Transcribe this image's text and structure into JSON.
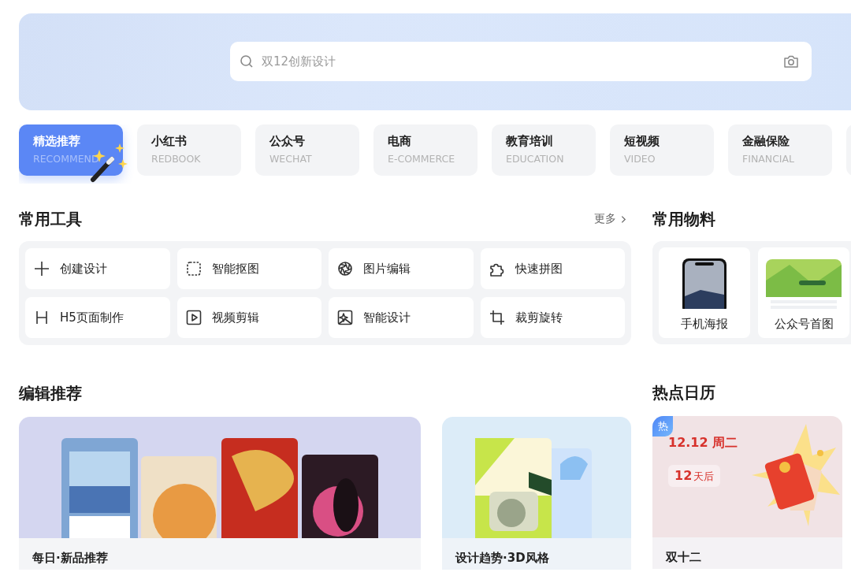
{
  "search": {
    "placeholder": "双12创新设计"
  },
  "categories": [
    {
      "title": "精选推荐",
      "subtitle": "RECOMMEND",
      "selected": true
    },
    {
      "title": "小红书",
      "subtitle": "REDBOOK",
      "selected": false
    },
    {
      "title": "公众号",
      "subtitle": "WECHAT",
      "selected": false
    },
    {
      "title": "电商",
      "subtitle": "E-COMMERCE",
      "selected": false
    },
    {
      "title": "教育培训",
      "subtitle": "EDUCATION",
      "selected": false
    },
    {
      "title": "短视频",
      "subtitle": "VIDEO",
      "selected": false
    },
    {
      "title": "金融保险",
      "subtitle": "FINANCIAL",
      "selected": false
    }
  ],
  "tools": {
    "title": "常用工具",
    "more": "更多",
    "items": [
      {
        "label": "创建设计"
      },
      {
        "label": "智能抠图"
      },
      {
        "label": "图片编辑"
      },
      {
        "label": "快速拼图"
      },
      {
        "label": "H5页面制作"
      },
      {
        "label": "视频剪辑"
      },
      {
        "label": "智能设计"
      },
      {
        "label": "裁剪旋转"
      }
    ]
  },
  "materials": {
    "title": "常用物料",
    "items": [
      {
        "label": "手机海报"
      },
      {
        "label": "公众号首图"
      }
    ]
  },
  "editor": {
    "title": "编辑推荐",
    "cards": [
      {
        "caption": "每日·新品推荐"
      },
      {
        "caption": "设计趋势·3D风格"
      }
    ]
  },
  "calendar": {
    "title": "热点日历",
    "badge": "热",
    "date": "12.12 周二",
    "count": "12",
    "unit": "天后",
    "caption": "双十二"
  }
}
